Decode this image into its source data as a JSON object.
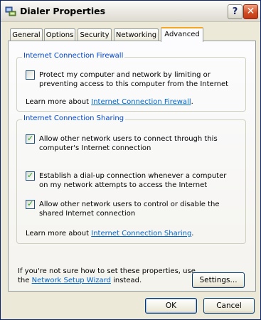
{
  "window": {
    "title": "Dialer Properties",
    "help_glyph": "?",
    "close_glyph": "✕",
    "icon": "network-connection-icon"
  },
  "tabs": [
    {
      "label": "General",
      "active": false
    },
    {
      "label": "Options",
      "active": false
    },
    {
      "label": "Security",
      "active": false
    },
    {
      "label": "Networking",
      "active": false
    },
    {
      "label": "Advanced",
      "active": true
    }
  ],
  "firewall": {
    "legend": "Internet Connection Firewall",
    "checkbox_label": "Protect my computer and network by limiting or preventing access to this computer from the Internet",
    "checked": false,
    "learn_prefix": "Learn more about ",
    "learn_link": "Internet Connection Firewall",
    "learn_suffix": "."
  },
  "sharing": {
    "legend": "Internet Connection Sharing",
    "options": [
      {
        "label": "Allow other network users to connect through this computer's Internet connection",
        "checked": true
      },
      {
        "label": "Establish a dial-up connection whenever a computer on my network attempts to access the Internet",
        "checked": true
      },
      {
        "label": "Allow other network users to control or disable the shared Internet connection",
        "checked": true
      }
    ],
    "learn_prefix": "Learn more about ",
    "learn_link": "Internet Connection Sharing",
    "learn_suffix": "."
  },
  "footer_note": {
    "line1": "If you're not sure how to set these properties, use",
    "line2_prefix": "the ",
    "wizard_link": "Network Setup Wizard",
    "line2_suffix": " instead."
  },
  "buttons": {
    "settings": "Settings...",
    "ok": "OK",
    "cancel": "Cancel"
  },
  "colors": {
    "link": "#0066cc",
    "legend": "#0046d5",
    "tab_highlight": "#f5a623",
    "close_button": "#d04a20",
    "check": "#21a121"
  }
}
